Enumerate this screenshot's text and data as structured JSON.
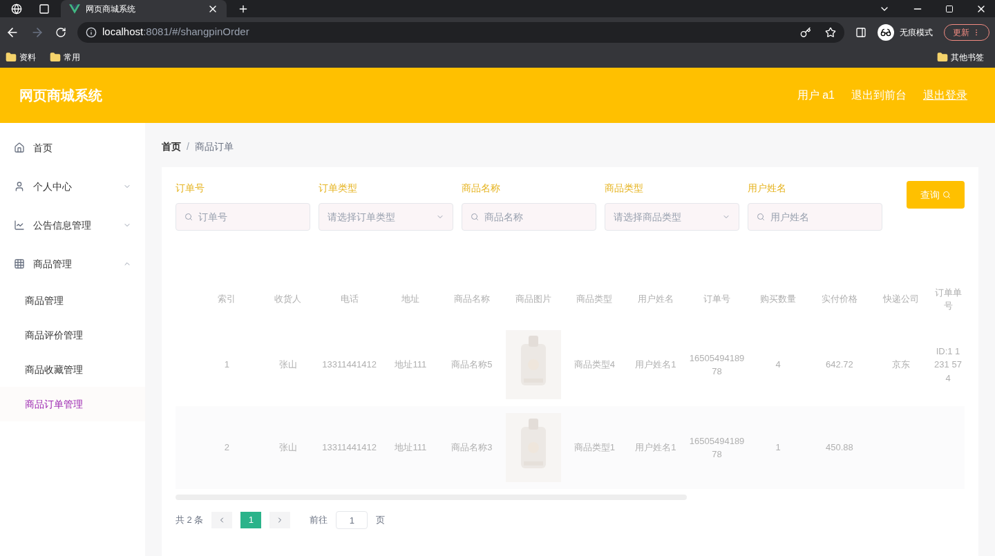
{
  "browser": {
    "tab_title": "网页商城系统",
    "url_host": "localhost",
    "url_rest": ":8081/#/shangpinOrder",
    "incognito": "无痕模式",
    "update": "更新",
    "bookmarks": [
      "资料",
      "常用"
    ],
    "other_bookmarks": "其他书签"
  },
  "header": {
    "title": "网页商城系统",
    "links": [
      "用户 a1",
      "退出到前台",
      "退出登录"
    ]
  },
  "sidebar": {
    "items": [
      {
        "label": "首页"
      },
      {
        "label": "个人中心",
        "expanded": false
      },
      {
        "label": "公告信息管理",
        "expanded": false
      },
      {
        "label": "商品管理",
        "expanded": true,
        "children": [
          {
            "label": "商品管理",
            "selected": false
          },
          {
            "label": "商品评价管理",
            "selected": false
          },
          {
            "label": "商品收藏管理",
            "selected": false
          },
          {
            "label": "商品订单管理",
            "selected": true
          }
        ]
      }
    ]
  },
  "breadcrumb": [
    "首页",
    "商品订单"
  ],
  "breadcrumb_separator": "/",
  "filters": [
    {
      "label": "订单号",
      "kind": "search",
      "placeholder": "订单号"
    },
    {
      "label": "订单类型",
      "kind": "select",
      "placeholder": "请选择订单类型"
    },
    {
      "label": "商品名称",
      "kind": "search",
      "placeholder": "商品名称"
    },
    {
      "label": "商品类型",
      "kind": "select",
      "placeholder": "请选择商品类型"
    },
    {
      "label": "用户姓名",
      "kind": "search",
      "placeholder": "用户姓名"
    }
  ],
  "search_button": "查询",
  "table": {
    "columns": [
      "索引",
      "收货人",
      "电话",
      "地址",
      "商品名称",
      "商品图片",
      "商品类型",
      "用户姓名",
      "订单号",
      "购买数量",
      "实付价格",
      "快递公司",
      "订单单号"
    ],
    "rows": [
      [
        "1",
        "张山",
        "13311441412",
        "地址111",
        "商品名称5",
        "",
        "商品类型4",
        "用户姓名1",
        "1650549418978",
        "4",
        "642.72",
        "京东",
        "ID:1 1231 574"
      ],
      [
        "2",
        "张山",
        "13311441412",
        "地址111",
        "商品名称3",
        "",
        "商品类型1",
        "用户姓名1",
        "1650549418978",
        "1",
        "450.88",
        "",
        ""
      ]
    ]
  },
  "pagination": {
    "total": "共 2 条",
    "pages": [
      {
        "label": "1",
        "selected": true
      }
    ],
    "goto": "前往",
    "goto_value": "1",
    "page_unit": "页"
  }
}
